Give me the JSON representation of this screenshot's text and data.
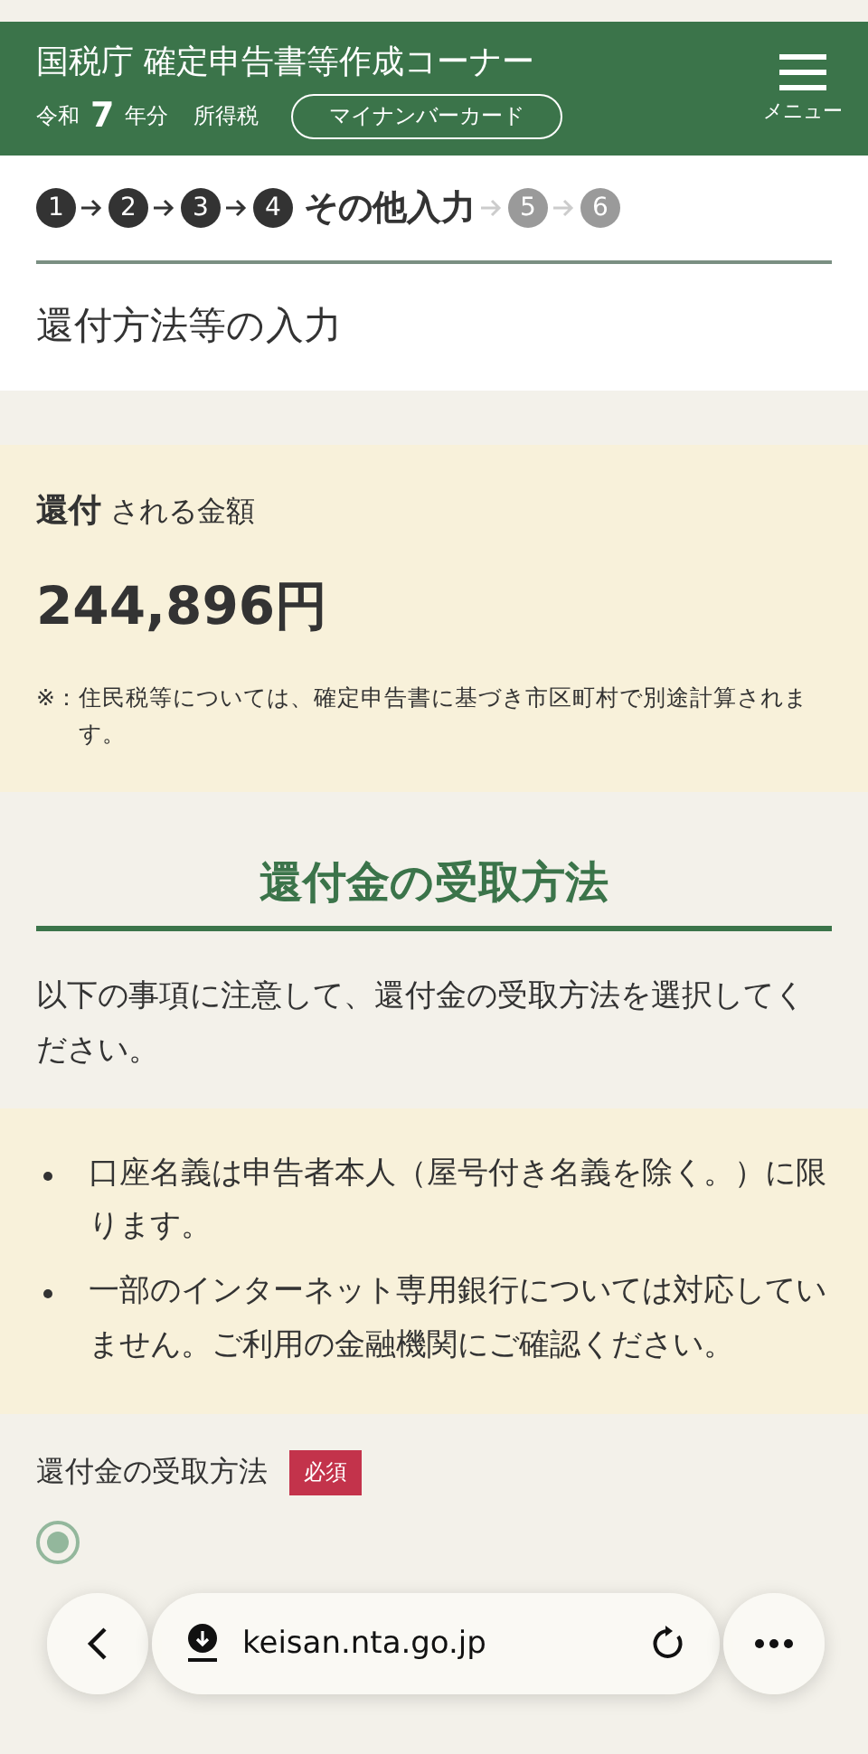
{
  "header": {
    "title": "国税庁 確定申告書等作成コーナー",
    "era": "令和",
    "year": "7",
    "year_suffix": "年分",
    "tax_type": "所得税",
    "card_button": "マイナンバーカード",
    "menu_label": "メニュー"
  },
  "steps": [
    {
      "number": "1",
      "kind": "done"
    },
    {
      "number": "2",
      "kind": "done"
    },
    {
      "number": "3",
      "kind": "done"
    },
    {
      "number": "4",
      "kind": "current",
      "label": "その他入力"
    },
    {
      "number": "5",
      "kind": "upcoming"
    },
    {
      "number": "6",
      "kind": "upcoming"
    }
  ],
  "page_title": "還付方法等の入力",
  "refund": {
    "label_bold": "還付",
    "label": "される金額",
    "amount": "244,896円",
    "note_mark": "※：",
    "note": "住民税等については、確定申告書に基づき市区町村で別途計算されます。"
  },
  "section": {
    "heading": "還付金の受取方法",
    "intro": "以下の事項に注意して、還付金の受取方法を選択してください。",
    "bullets": [
      "口座名義は申告者本人（屋号付き名義を除く。）に限ります。",
      "一部のインターネット専用銀行については対応していません。ご利用の金融機関にご確認ください。"
    ]
  },
  "field": {
    "label": "還付金の受取方法",
    "required_badge": "必須",
    "option_selected": true
  },
  "browser_bar": {
    "url": "keisan.nta.go.jp"
  }
}
